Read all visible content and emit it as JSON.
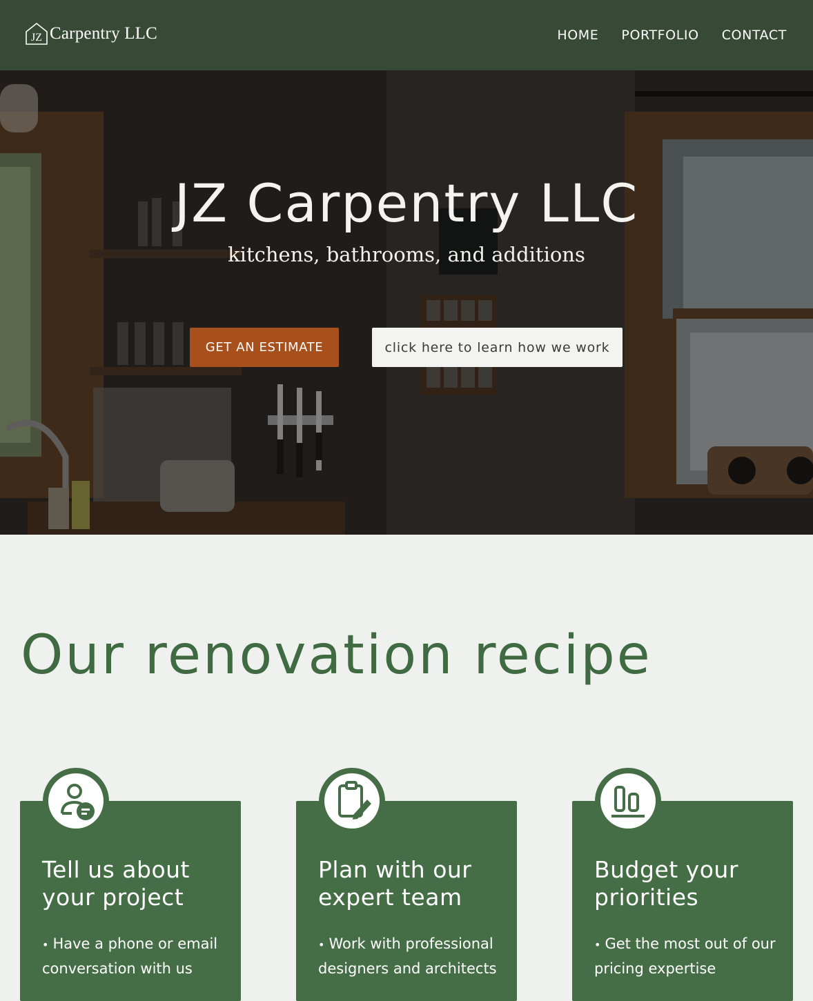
{
  "header": {
    "logo_text": "Carpentry LLC",
    "logo_icon": "jz-house-logo",
    "nav": [
      {
        "label": "HOME"
      },
      {
        "label": "PORTFOLIO"
      },
      {
        "label": "CONTACT"
      }
    ]
  },
  "hero": {
    "title": "JZ Carpentry LLC",
    "subtitle": "kitchens, bathrooms, and additions",
    "primary_button": "GET AN ESTIMATE",
    "secondary_button": "click here to learn how we work",
    "background": "kitchen-photo"
  },
  "recipe": {
    "title": "Our renovation recipe",
    "cards": [
      {
        "icon": "user-chat-icon",
        "title": "Tell us about your project",
        "bullet": "Have a phone or email conversation with us"
      },
      {
        "icon": "clipboard-edit-icon",
        "title": "Plan with our expert team",
        "bullet": "Work with professional designers and architects"
      },
      {
        "icon": "bar-chart-icon",
        "title": "Budget your priorities",
        "bullet": "Get the most out of our pricing expertise"
      }
    ]
  },
  "colors": {
    "header_bg": "#364a35",
    "accent_green": "#456e47",
    "title_green": "#3f6a42",
    "estimate_orange": "#a8501c",
    "page_bg": "#eff1ef"
  }
}
